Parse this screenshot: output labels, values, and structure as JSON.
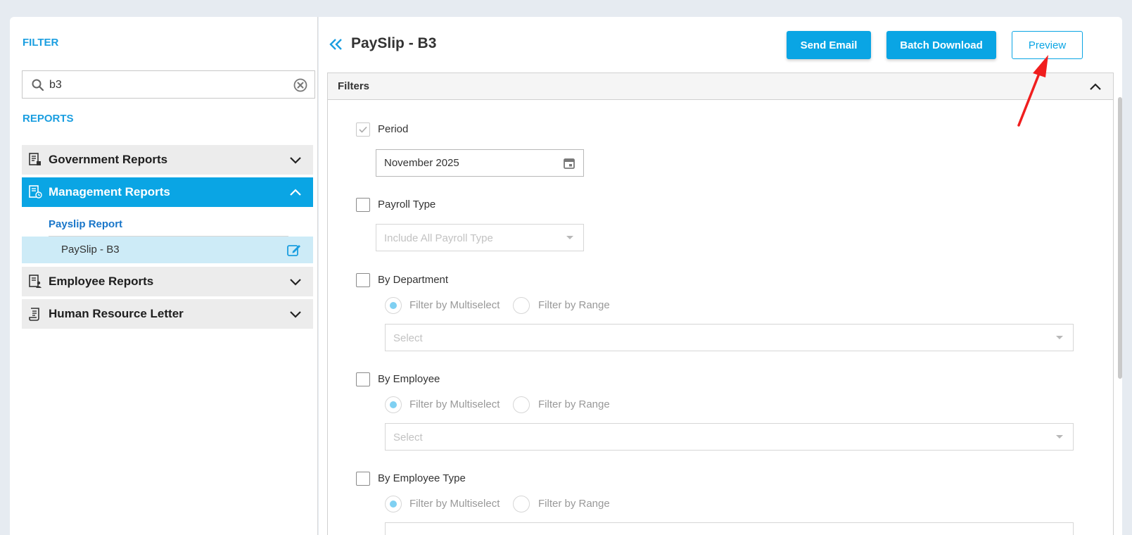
{
  "sidebar": {
    "filter_label": "FILTER",
    "search": {
      "value": "b3",
      "placeholder": ""
    },
    "reports_label": "REPORTS",
    "groups": [
      {
        "label": "Government Reports",
        "icon": "report-document-icon",
        "expanded": false
      },
      {
        "label": "Management Reports",
        "icon": "report-clock-icon",
        "expanded": true
      },
      {
        "label": "Employee Reports",
        "icon": "employee-report-icon",
        "expanded": false
      },
      {
        "label": "Human Resource Letter",
        "icon": "letter-scroll-icon",
        "expanded": false
      }
    ],
    "sub_heading": "Payslip Report",
    "sub_item": {
      "label": "PaySlip - B3",
      "icon": "edit-icon"
    }
  },
  "header": {
    "title": "PaySlip - B3",
    "send_email_label": "Send Email",
    "batch_download_label": "Batch Download",
    "preview_label": "Preview"
  },
  "filters": {
    "title": "Filters",
    "period": {
      "label": "Period",
      "checked": true,
      "value": "November 2025"
    },
    "payroll_type": {
      "label": "Payroll Type",
      "checked": false,
      "placeholder": "Include All Payroll Type"
    },
    "by_department": {
      "label": "By Department",
      "checked": false,
      "option_multiselect": "Filter by Multiselect",
      "option_range": "Filter by Range",
      "placeholder": "Select"
    },
    "by_employee": {
      "label": "By Employee",
      "checked": false,
      "option_multiselect": "Filter by Multiselect",
      "option_range": "Filter by Range",
      "placeholder": "Select"
    },
    "by_employee_type": {
      "label": "By Employee Type",
      "checked": false,
      "option_multiselect": "Filter by Multiselect",
      "option_range": "Filter by Range"
    }
  },
  "colors": {
    "accent": "#0aa5e4",
    "link": "#1976c9",
    "annotation_arrow": "#f01e1e"
  }
}
